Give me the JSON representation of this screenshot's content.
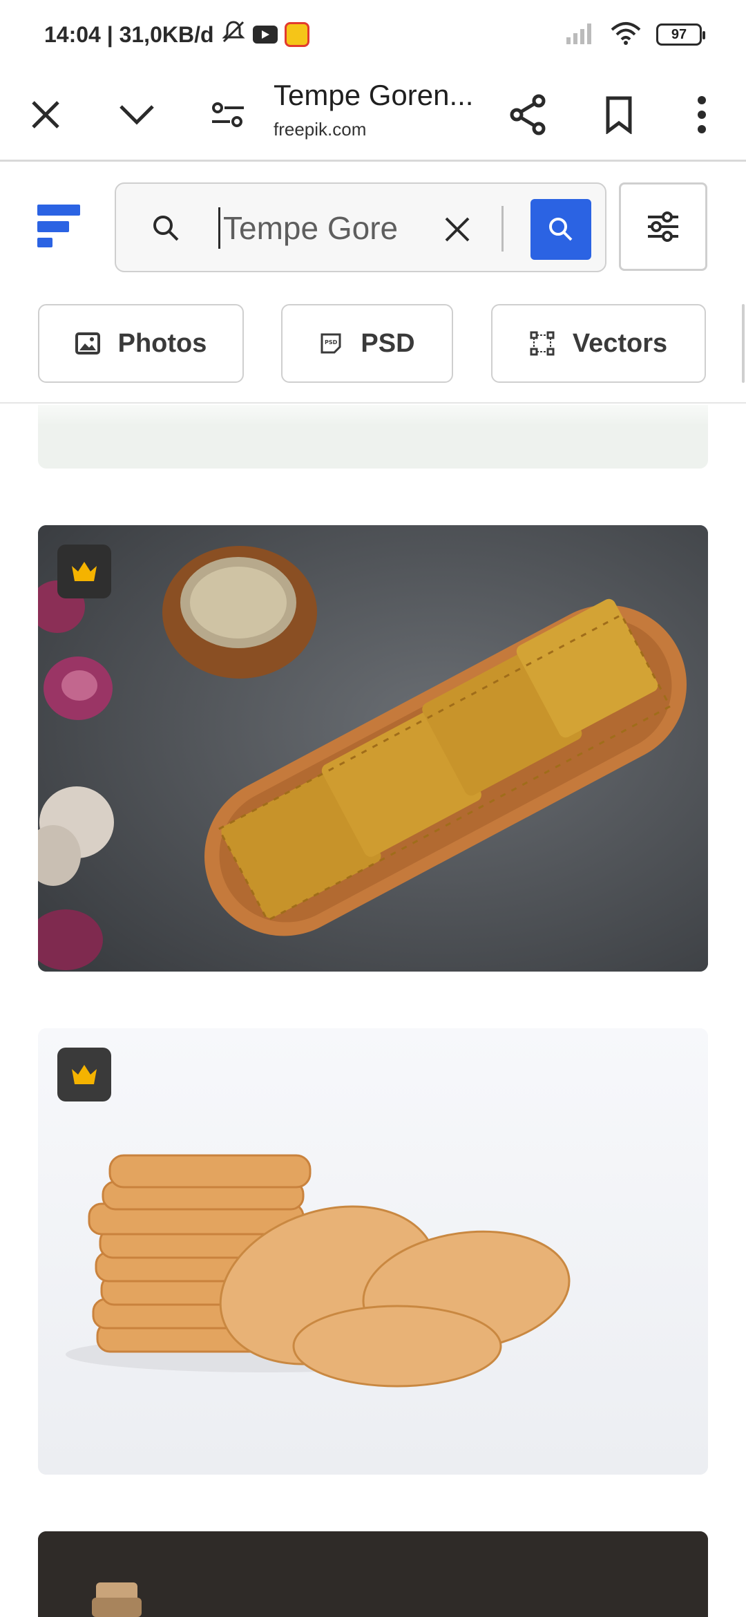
{
  "status_bar": {
    "time_and_speed": "14:04 | 31,0KB/d",
    "battery": "97"
  },
  "toolbar": {
    "tab_title": "Tempe Goren...",
    "domain": "freepik.com"
  },
  "search": {
    "query": "Tempe Gore"
  },
  "chips": [
    {
      "label": "Photos",
      "icon": "image-icon"
    },
    {
      "label": "PSD",
      "icon": "psd-icon"
    },
    {
      "label": "Vectors",
      "icon": "vector-icon"
    }
  ],
  "results": [
    {
      "premium": true,
      "icon": "crown-icon"
    },
    {
      "premium": true,
      "icon": "crown-icon"
    }
  ],
  "colors": {
    "brand_blue": "#2b63e3",
    "premium_gold": "#f5b300",
    "chip_border": "#cfcfcf"
  }
}
